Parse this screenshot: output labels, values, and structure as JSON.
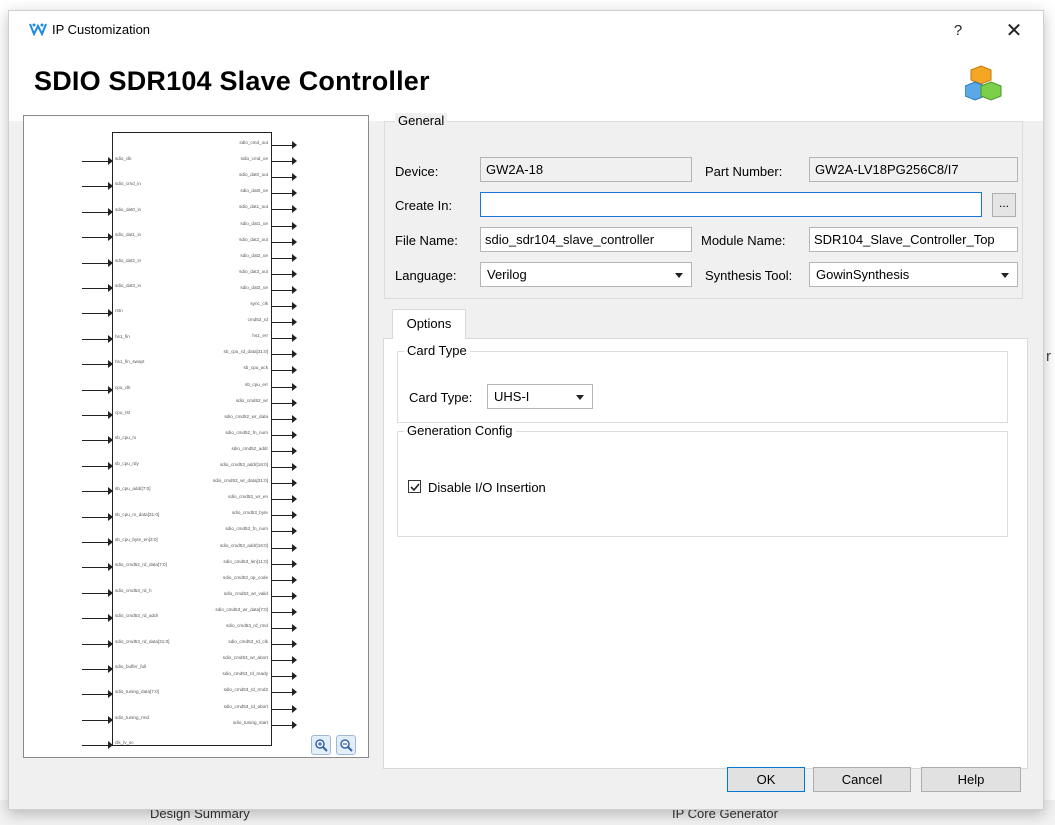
{
  "window": {
    "title": "IP Customization",
    "help_glyph": "?",
    "close_glyph": "✕"
  },
  "header": {
    "title": "SDIO SDR104 Slave Controller"
  },
  "general": {
    "legend": "General",
    "device_label": "Device:",
    "device_value": "GW2A-18",
    "part_label": "Part Number:",
    "part_value": "GW2A-LV18PG256C8/I7",
    "create_in_label": "Create In:",
    "create_in_value": "",
    "browse_label": "...",
    "file_name_label": "File Name:",
    "file_name_value": "sdio_sdr104_slave_controller",
    "module_name_label": "Module Name:",
    "module_name_value": "SDR104_Slave_Controller_Top",
    "language_label": "Language:",
    "language_value": "Verilog",
    "synthesis_label": "Synthesis Tool:",
    "synthesis_value": "GowinSynthesis"
  },
  "options": {
    "tab_label": "Options",
    "card_type_legend": "Card Type",
    "card_type_label": "Card Type:",
    "card_type_value": "UHS-I",
    "gen_config_legend": "Generation Config",
    "disable_io_label": "Disable I/O Insertion",
    "disable_io_checked": true
  },
  "buttons": {
    "ok": "OK",
    "cancel": "Cancel",
    "help": "Help"
  },
  "background": {
    "tab_left": "Design Summary",
    "tab_right": "IP Core Generator",
    "edge_glyph": "r"
  },
  "symbol": {
    "inputs": [
      "sdio_clk",
      "sdio_cmd_in",
      "sdio_dat0_in",
      "sdio_dat1_in",
      "sdio_dat2_in",
      "sdio_dat3_in",
      "rstn",
      "hs1_fin",
      "hs1_fin_swapt",
      "cpu_clk",
      "cpu_rst",
      "sb_cpu_rx",
      "sb_cpu_rdy",
      "sb_cpu_addr[7:0]",
      "sb_cpu_rx_data[31:0]",
      "sb_cpu_byte_en[3:0]",
      "sdio_cmd52_rd_data[7:0]",
      "sdio_cmd53_rd_h",
      "sdio_cmd53_rd_addr",
      "sdio_cmd53_rd_data[31:0]",
      "sdio_buffer_full",
      "sdio_tuning_data[7:0]",
      "sdio_tuning_rmd",
      "clk_lv_sc"
    ],
    "outputs": [
      "sdio_cmd_out",
      "sdio_cmd_oe",
      "sdio_dat0_out",
      "sdio_dat0_oe",
      "sdio_dat1_out",
      "sdio_dat1_oe",
      "sdio_dat2_out",
      "sdio_dat2_oe",
      "sdio_dat3_out",
      "sdio_dat3_oe",
      "sync_clk",
      "cmd52_rd",
      "hs1_err",
      "sb_cpu_rd_data[31:0]",
      "sb_cpu_ack",
      "sb_cpu_err",
      "sdio_cmd52_wr",
      "sdio_cmd52_wr_data",
      "sdio_cmd52_fn_num",
      "sdio_cmd52_addr",
      "sdio_cmd53_addr[16:0]",
      "sdio_cmd53_wr_data[31:0]",
      "sdio_cmd53_wr_en",
      "sdio_cmd53_byte",
      "sdio_cmd53_fn_num",
      "sdio_cmd53_addr[16:0]",
      "sdio_cmd53_len[11:0]",
      "sdio_cmd53_op_code",
      "sdio_cmd53_wr_valid",
      "sdio_cmd53_wr_data[7:0]",
      "sdio_cmd53_rd_rmd",
      "sdio_cmd53_rd_clk",
      "sdio_cmd53_wr_abort",
      "sdio_cmd53_rd_ready",
      "sdio_cmd53_rd_rmd2",
      "sdio_cmd53_rd_abort",
      "sdio_tuning_start"
    ]
  }
}
